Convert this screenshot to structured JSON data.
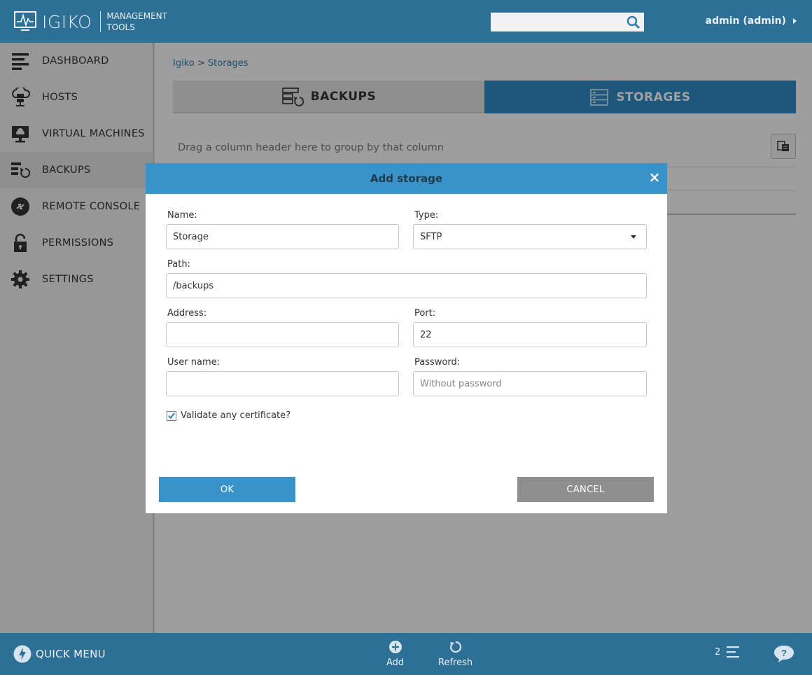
{
  "header": {
    "brand": "IGIKO",
    "tagline_line1": "MANAGEMENT",
    "tagline_line2": "TOOLS",
    "search_placeholder": "",
    "user": "admin (admin)"
  },
  "sidebar": {
    "items": [
      {
        "label": "DASHBOARD",
        "icon": "dashboard-icon"
      },
      {
        "label": "HOSTS",
        "icon": "hosts-icon"
      },
      {
        "label": "VIRTUAL MACHINES",
        "icon": "virtual-machines-icon"
      },
      {
        "label": "BACKUPS",
        "icon": "backups-icon",
        "active": true
      },
      {
        "label": "REMOTE CONSOLE",
        "icon": "remote-console-icon"
      },
      {
        "label": "PERMISSIONS",
        "icon": "lock-icon"
      },
      {
        "label": "SETTINGS",
        "icon": "gear-icon"
      }
    ]
  },
  "breadcrumb": {
    "root": "Igiko",
    "separator": ">",
    "current": "Storages"
  },
  "tabs": {
    "backups": "BACKUPS",
    "storages": "STORAGES"
  },
  "grid": {
    "group_hint": "Drag a column header here to group by that column"
  },
  "modal": {
    "title": "Add storage",
    "close": "×",
    "name_label": "Name:",
    "name_value": "Storage",
    "type_label": "Type:",
    "type_value": "SFTP",
    "path_label": "Path:",
    "path_value": "/backups",
    "address_label": "Address:",
    "address_value": "",
    "port_label": "Port:",
    "port_value": "22",
    "username_label": "User name:",
    "username_value": "",
    "password_label": "Password:",
    "password_placeholder": "Without password",
    "validate_label": "Validate any certificate?",
    "validate_checked": true,
    "ok": "OK",
    "cancel": "CANCEL"
  },
  "bottombar": {
    "quick_menu": "QUICK MENU",
    "add": "Add",
    "refresh": "Refresh",
    "task_count": "2"
  },
  "colors": {
    "primary": "#2e6f96",
    "accent": "#3a93c8",
    "active_tab": "#2f8cc4",
    "cancel": "#8e8e8e"
  }
}
